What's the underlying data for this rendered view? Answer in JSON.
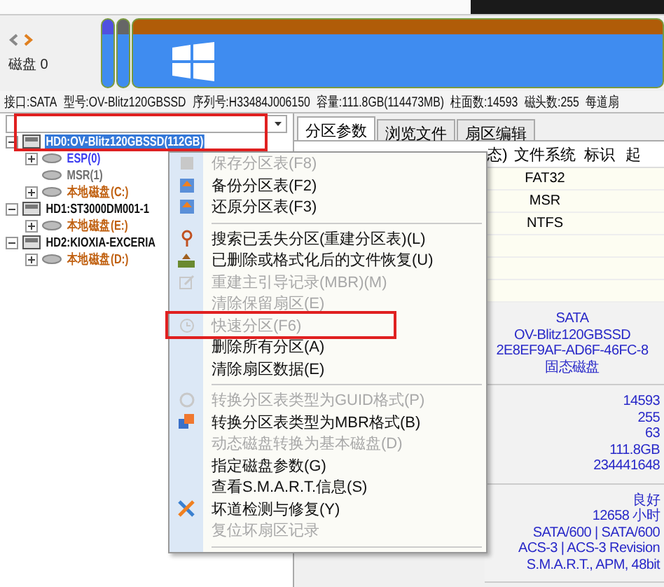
{
  "disk_map": {
    "label": "磁盘 0"
  },
  "info_bar": [
    "接口:SATA",
    "型号:OV-Blitz120GBSSD",
    "序列号:H33484J006150",
    "容量:111.8GB(114473MB)",
    "柱面数:14593",
    "磁头数:255",
    "每道扇"
  ],
  "tree": [
    {
      "label": "HD0:OV-Blitz120GBSSD(112GB)",
      "kind": "disk",
      "selected": true,
      "expanded": true,
      "children": [
        {
          "label": "ESP(0)",
          "kind": "partition",
          "selected": false,
          "expanded": false,
          "color": "#3b3bf0"
        },
        {
          "label": "MSR(1)",
          "kind": "partition",
          "selected": false,
          "color": "#707070"
        },
        {
          "label": "本地磁盘(C:)",
          "kind": "partition",
          "selected": false,
          "expanded": false,
          "color": "#c06010"
        }
      ]
    },
    {
      "label": "HD1:ST3000DM001-1",
      "kind": "disk",
      "selected": false,
      "expanded": true,
      "children": [
        {
          "label": "本地磁盘(E:)",
          "kind": "partition",
          "selected": false,
          "expanded": false,
          "color": "#c06010"
        }
      ]
    },
    {
      "label": "HD2:KIOXIA-EXCERIA",
      "kind": "disk",
      "selected": false,
      "expanded": true,
      "children": [
        {
          "label": "本地磁盘(D:)",
          "kind": "partition",
          "selected": false,
          "expanded": false,
          "color": "#c06010"
        }
      ]
    }
  ],
  "tabs": [
    {
      "label": "分区参数",
      "selected": true
    },
    {
      "label": "浏览文件",
      "selected": false
    },
    {
      "label": "扇区编辑",
      "selected": false
    }
  ],
  "table": {
    "columns": [
      "态)",
      "文件系统",
      "标识",
      "起"
    ],
    "rows": [
      {
        "file_system": "FAT32"
      },
      {
        "file_system": "MSR"
      },
      {
        "file_system": "NTFS"
      }
    ]
  },
  "details": [
    [
      "SATA",
      "OV-Blitz120GBSSD",
      "2E8EF9AF-AD6F-46FC-8",
      "固态磁盘"
    ],
    [
      "14593",
      "255",
      "63",
      "111.8GB",
      "234441648"
    ],
    [
      "良好",
      "12658 小时",
      "SATA/600 | SATA/600",
      "ACS-3 | ACS-3 Revision",
      "S.M.A.R.T., APM, 48bit"
    ]
  ],
  "context_menu": [
    {
      "kind": "item",
      "label": "保存分区表(F8)",
      "disabled": true
    },
    {
      "kind": "item",
      "label": "备份分区表(F2)",
      "disabled": false
    },
    {
      "kind": "item",
      "label": "还原分区表(F3)",
      "disabled": false
    },
    {
      "kind": "separator"
    },
    {
      "kind": "item",
      "label": "搜索已丢失分区(重建分区表)(L)",
      "disabled": false
    },
    {
      "kind": "item",
      "label": "已删除或格式化后的文件恢复(U)",
      "disabled": false
    },
    {
      "kind": "item",
      "label": "重建主引导记录(MBR)(M)",
      "disabled": true
    },
    {
      "kind": "item",
      "label": "清除保留扇区(E)",
      "disabled": true
    },
    {
      "kind": "item",
      "label": "快速分区(F6)",
      "disabled": true
    },
    {
      "kind": "item",
      "label": "删除所有分区(A)",
      "disabled": false
    },
    {
      "kind": "item",
      "label": "清除扇区数据(E)",
      "disabled": false
    },
    {
      "kind": "separator"
    },
    {
      "kind": "item",
      "label": "转换分区表类型为GUID格式(P)",
      "disabled": true
    },
    {
      "kind": "item",
      "label": "转换分区表类型为MBR格式(B)",
      "disabled": false
    },
    {
      "kind": "item",
      "label": "动态磁盘转换为基本磁盘(D)",
      "disabled": true
    },
    {
      "kind": "item",
      "label": "指定磁盘参数(G)",
      "disabled": false
    },
    {
      "kind": "item",
      "label": "查看S.M.A.R.T.信息(S)",
      "disabled": false
    },
    {
      "kind": "item",
      "label": "坏道检测与修复(Y)",
      "disabled": false
    },
    {
      "kind": "item",
      "label": "复位坏扇区记录",
      "disabled": true
    },
    {
      "kind": "separator"
    }
  ]
}
